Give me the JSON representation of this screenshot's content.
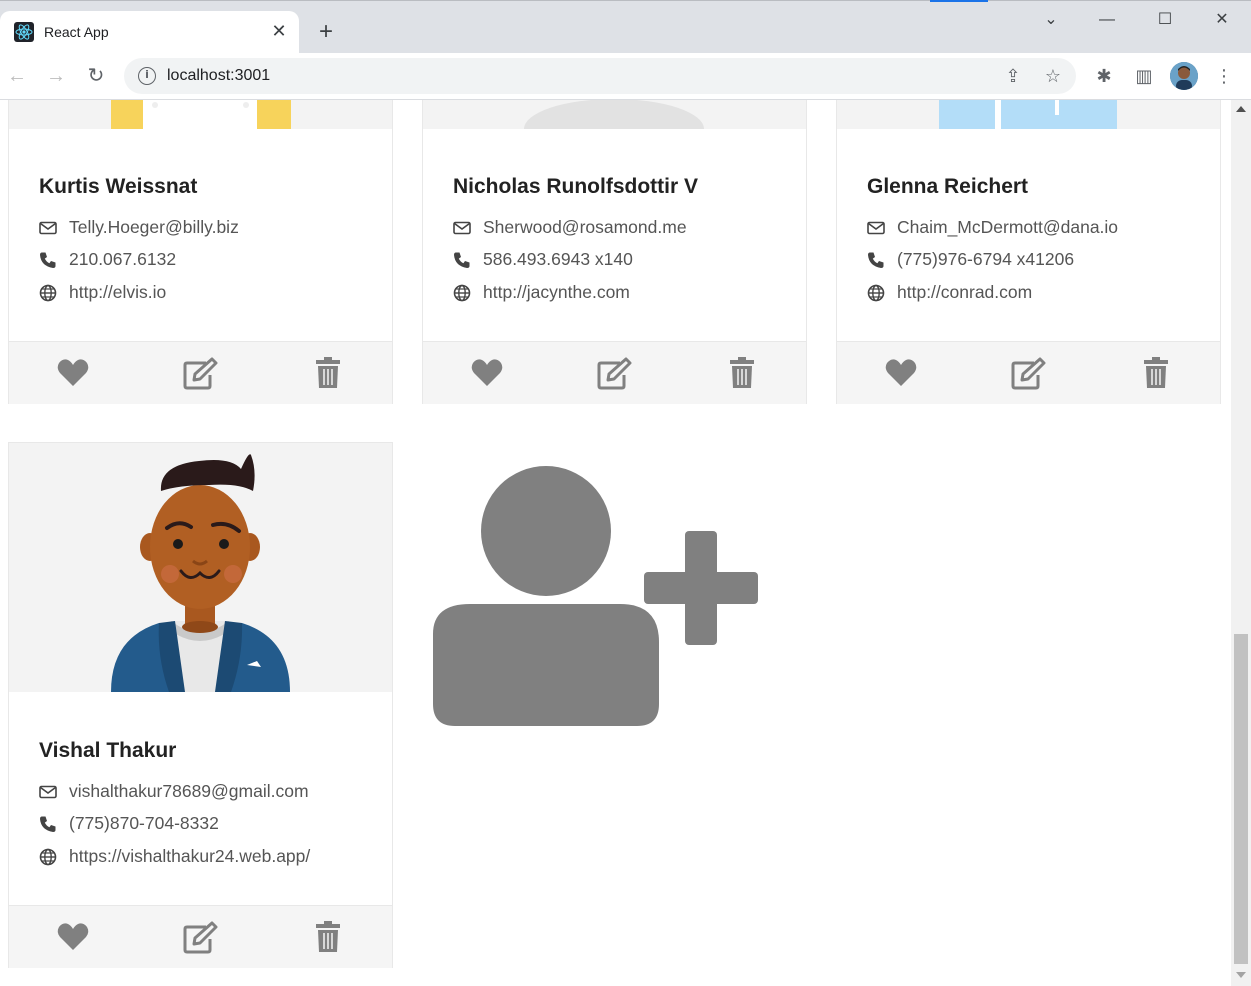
{
  "browser": {
    "tab_title": "React App",
    "url": "localhost:3001",
    "favicon": "react-logo-icon",
    "close_symbol": "✕",
    "new_tab_symbol": "+",
    "window_controls": {
      "tabsearch": "⌄",
      "minimize": "—",
      "maximize": "☐",
      "close": "✕"
    },
    "nav": {
      "back": "←",
      "forward": "→",
      "reload": "↻"
    },
    "actions": {
      "share": "⇪",
      "bookmark": "☆",
      "extensions": "✱",
      "sidepanel": "▥",
      "menu": "⋮"
    },
    "info_symbol": "i"
  },
  "colors": {
    "icon_gray": "#808080",
    "text_gray": "#555555",
    "card_bg": "#f3f3f3",
    "actions_bg": "#f5f5f5"
  },
  "contacts": [
    {
      "name": "Kurtis Weissnat",
      "email": "Telly.Hoeger@billy.biz",
      "phone": "210.067.6132",
      "website": "http://elvis.io"
    },
    {
      "name": "Nicholas Runolfsdottir V",
      "email": "Sherwood@rosamond.me",
      "phone": "586.493.6943 x140",
      "website": "http://jacynthe.com"
    },
    {
      "name": "Glenna Reichert",
      "email": "Chaim_McDermott@dana.io",
      "phone": "(775)976-6794 x41206",
      "website": "http://conrad.com"
    },
    {
      "name": "Vishal Thakur",
      "email": "vishalthakur78689@gmail.com",
      "phone": "(775)870-704-8332",
      "website": "https://vishalthakur24.web.app/"
    }
  ],
  "icons": {
    "email": "envelope-icon",
    "phone": "phone-icon",
    "website": "globe-icon",
    "like": "heart-icon",
    "edit": "edit-icon",
    "delete": "trash-icon",
    "add_contact": "user-plus-icon"
  }
}
